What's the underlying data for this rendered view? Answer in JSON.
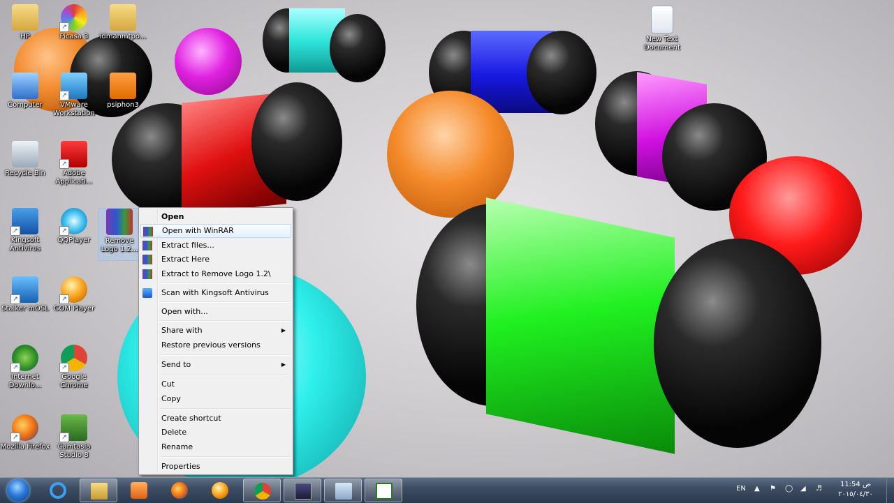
{
  "desktop_icons": [
    {
      "label": "HP"
    },
    {
      "label": "Picasa 3"
    },
    {
      "label": "idmanmtpo..."
    },
    {
      "label": "Computer"
    },
    {
      "label": "VMware Workstation"
    },
    {
      "label": "psiphon3"
    },
    {
      "label": "Recycle Bin"
    },
    {
      "label": "Adobe Applicati..."
    },
    {
      "label": "Kingsoft Antivirus"
    },
    {
      "label": "QQPlayer"
    },
    {
      "label": "Remove Logo 1.2..."
    },
    {
      "label": "Stalker mOSL"
    },
    {
      "label": "GOM Player"
    },
    {
      "label": "Internet Downlo..."
    },
    {
      "label": "Google Chrome"
    },
    {
      "label": "Mozilla Firefox"
    },
    {
      "label": "Camtasia Studio 8"
    },
    {
      "label": "New Text Document"
    }
  ],
  "context_menu": {
    "items": [
      {
        "label": "Open"
      },
      {
        "label": "Open with WinRAR"
      },
      {
        "label": "Extract files..."
      },
      {
        "label": "Extract Here"
      },
      {
        "label": "Extract to Remove Logo 1.2\\"
      },
      {
        "label": "Scan with Kingsoft Antivirus"
      },
      {
        "label": "Open with..."
      },
      {
        "label": "Share with"
      },
      {
        "label": "Restore previous versions"
      },
      {
        "label": "Send to"
      },
      {
        "label": "Cut"
      },
      {
        "label": "Copy"
      },
      {
        "label": "Create shortcut"
      },
      {
        "label": "Delete"
      },
      {
        "label": "Rename"
      },
      {
        "label": "Properties"
      }
    ]
  },
  "taskbar": {
    "pinned": [
      "internet-explorer-icon",
      "file-explorer-icon",
      "media-player-icon",
      "firefox-icon",
      "gom-player-icon",
      "chrome-icon",
      "remove-logo-icon",
      "virtual-disk-icon",
      "camtasia-icon"
    ],
    "tray": {
      "language": "EN",
      "clock_time": "11:54 ص",
      "clock_date": "٢٠١٥/٠٤/٣٠"
    }
  },
  "colors": {
    "menu_bg": "#f0f0f0",
    "menu_highlight": "#e5f0fb",
    "taskbar": "#3e4d63"
  }
}
